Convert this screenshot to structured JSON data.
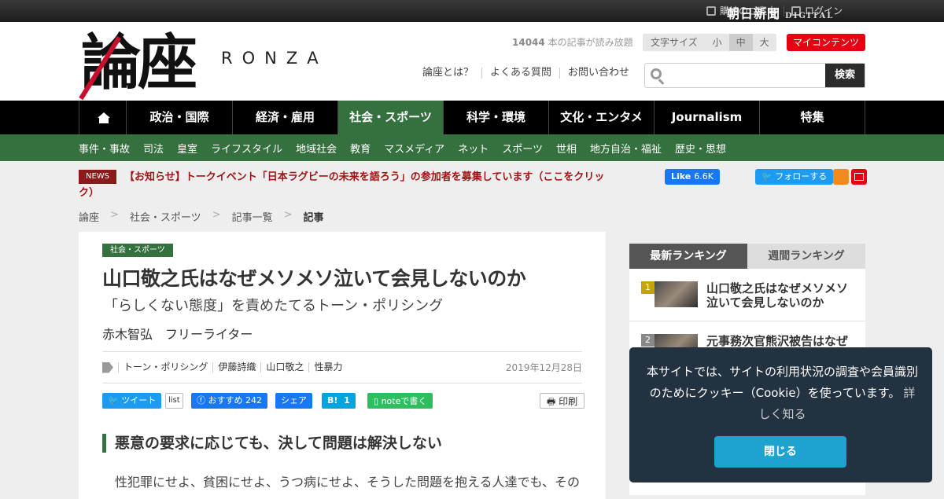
{
  "topbar": {
    "subscribe": "購読のご案内",
    "login": "ログイン",
    "brand": "朝日新聞",
    "brand_sub": "DIGITAL"
  },
  "header": {
    "logo_kanji": "論座",
    "logo_roman": "RONZA",
    "article_count": "14044",
    "article_count_suffix": "本の記事が読み放題",
    "fontsize_label": "文字サイズ",
    "fontsize_small": "小",
    "fontsize_medium": "中",
    "fontsize_large": "大",
    "fontsize_selected": "中",
    "mycontents": "マイコンテンツ",
    "links": [
      "論座とは？",
      "よくある質問",
      "お問い合わせ"
    ],
    "search_placeholder": "",
    "search_button": "検索"
  },
  "nav": {
    "items": [
      "政治・国際",
      "経済・雇用",
      "社会・スポーツ",
      "科学・環境",
      "文化・エンタメ",
      "Journalism",
      "特集"
    ],
    "active": "社会・スポーツ"
  },
  "subnav": {
    "items": [
      "事件・事故",
      "司法",
      "皇室",
      "ライフスタイル",
      "地域社会",
      "教育",
      "マスメディア",
      "ネット",
      "スポーツ",
      "世相",
      "地方自治・福祉",
      "歴史・思想"
    ]
  },
  "news": {
    "tag": "NEWS",
    "text": "【お知らせ】トークイベント「日本ラグビーの未来を語ろう」の参加者を募集しています（ここをクリック）"
  },
  "social": {
    "fb_like": "Like",
    "fb_count": "6.6K",
    "tw_follow": "フォローする"
  },
  "breadcrumb": [
    "論座",
    "社会・スポーツ",
    "記事一覧",
    "記事"
  ],
  "article": {
    "category": "社会・スポーツ",
    "title": "山口敬之氏はなぜメソメソ泣いて会見しないのか",
    "subtitle": "「らしくない態度」を責めたてるトーン・ポリシング",
    "author": "赤木智弘　フリーライター",
    "tags": [
      "トーン・ポリシング",
      "伊藤詩織",
      "山口敬之",
      "性暴力"
    ],
    "date": "2019年12月28日",
    "share": {
      "tweet": "ツイート",
      "list": "list",
      "fb_recommend": "おすすめ",
      "fb_count": "242",
      "fb_share": "シェア",
      "hatena_label": "B!",
      "hatena_count": "1",
      "note": "noteで書く",
      "print": "印刷"
    },
    "heading": "悪意の要求に応じても、決して問題は解決しない",
    "paragraph": "性犯罪にせよ、貧困にせよ、うつ病にせよ、そうした問題を抱える人達でも、その"
  },
  "ranking": {
    "tab_latest": "最新ランキング",
    "tab_weekly": "週間ランキング",
    "items": [
      {
        "rank": "1",
        "title": "山口敬之氏はなぜメソメソ泣いて会見しないのか"
      },
      {
        "rank": "2",
        "title": "元事務次官熊沢被告はなぜ"
      }
    ]
  },
  "cookie": {
    "message": "本サイトでは、サイトの利用状況の調査や会員識別のためにクッキー（Cookie）を使っています。",
    "more": "詳しく知る",
    "close": "閉じる"
  },
  "colors": {
    "accent_green": "#35703f",
    "brand_red": "#e60012",
    "news_red": "#a31515"
  }
}
